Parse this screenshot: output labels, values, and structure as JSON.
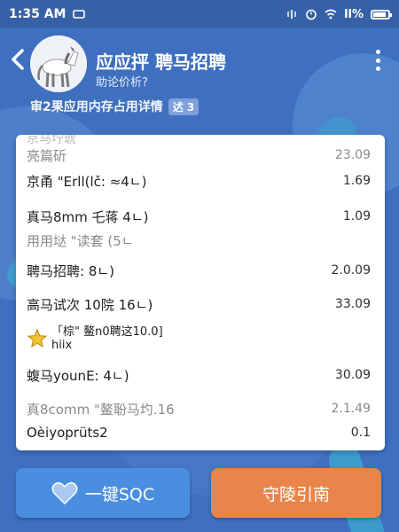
{
  "status_bar": {
    "time": "1:35 AM",
    "battery_text": "ll%",
    "battery_level": 0.9
  },
  "header": {
    "title": "应应抨 聘马招聘",
    "subtitle": "助论价析?",
    "info_text": "审2果应用内存占用详情",
    "info_badge": "迖 3"
  },
  "rows": [
    {
      "label": "亮篇斫",
      "value": "23.09"
    },
    {
      "label": "京甬 \"Erll(lč:  ≈4ㄴ)",
      "value": "1.69"
    },
    {
      "label": "真马8mm 乇蒋  4ㄴ)",
      "value": "1.09"
    },
    {
      "label": "用用垯 \"读套 (5ㄴ",
      "value": ""
    },
    {
      "label": "聘马招聘:  8ㄴ)",
      "value": "2.0.09"
    },
    {
      "label": "高马试次 10院 16ㄴ)",
      "value": "33.09"
    },
    {
      "label_line1": "「棕\" 鳌n0聘这10.0]",
      "label_line2": "hiix",
      "value": ""
    },
    {
      "label": "蝮马younE:  4ㄴ)",
      "value": "30.09"
    },
    {
      "label": "真8comm \"鳌聁马圴.16",
      "value": "2.1.49"
    },
    {
      "label": "Oèiyoprüts2",
      "value": "0.1"
    }
  ],
  "buttons": {
    "left_label": "一键SQC",
    "right_label": "守陵引南"
  },
  "icons": {
    "back": "chevron-left-icon",
    "menu": "more-vert-icon",
    "star": "star-icon",
    "heart": "heart-icon"
  },
  "colors": {
    "background": "#3f70bf",
    "left_button": "#4a8ee0",
    "right_button": "#e9854a",
    "star": "#f2c230"
  }
}
